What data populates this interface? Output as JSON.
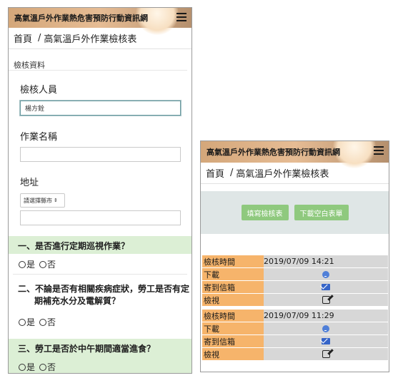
{
  "app": {
    "title": "高氣溫戶外作業熱危害預防行動資訊網",
    "breadcrumb_home": "首頁",
    "breadcrumb_sep": "/",
    "breadcrumb_current": "高氣溫戶外作業檢核表"
  },
  "form": {
    "section_label": "檢核資料",
    "inspector_label": "檢核人員",
    "inspector_value": "楊方銓",
    "job_label": "作業名稱",
    "job_value": "",
    "address_label": "地址",
    "county_select": "請選擇縣市",
    "address_value": ""
  },
  "questions": [
    {
      "text": "一、是否進行定期巡視作業？",
      "yes": "是",
      "no": "否"
    },
    {
      "text": "二、不論是否有相關疾病症狀，勞工是否有定期補充水分及電解質？",
      "yes": "是",
      "no": "否"
    },
    {
      "text": "三、勞工是否於中午期間適當進食？",
      "yes": "是",
      "no": "否"
    }
  ],
  "actions": {
    "fill_button": "填寫檢核表",
    "download_blank_button": "下載空白表單"
  },
  "record_labels": {
    "time": "檢核時間",
    "download": "下載",
    "email": "寄到信箱",
    "view": "檢視"
  },
  "records": [
    {
      "time": "2019/07/09 14:21"
    },
    {
      "time": "2019/07/09 11:29"
    }
  ],
  "icons": [
    "hamburger-menu-icon",
    "download-icon",
    "mail-icon",
    "edit-icon"
  ],
  "colors": {
    "header_gradient": "#e6bc94",
    "question_bg": "#dcefd5",
    "button_green": "#8fc97e",
    "record_key_bg": "#f6b46b",
    "record_val_bg": "#d7d7d7"
  }
}
